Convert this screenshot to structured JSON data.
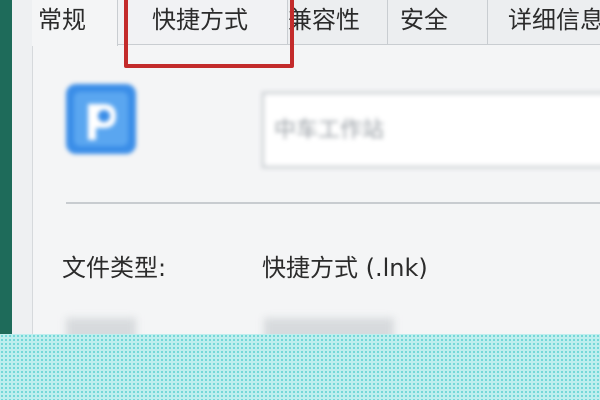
{
  "tabs": [
    {
      "label": "常规"
    },
    {
      "label": "快捷方式"
    },
    {
      "label": "兼容性"
    },
    {
      "label": "安全"
    },
    {
      "label": "详细信息"
    }
  ],
  "name_field": {
    "value": "中车工作站"
  },
  "properties": {
    "file_type_label": "文件类型:",
    "file_type_value": "快捷方式 (.lnk)"
  },
  "colors": {
    "highlight": "#c32b2b",
    "icon": "#3b8ee8",
    "accent_strip": "#1e6b5a",
    "overlay": "#bfeeee"
  },
  "icons": {
    "app": "app-icon"
  }
}
